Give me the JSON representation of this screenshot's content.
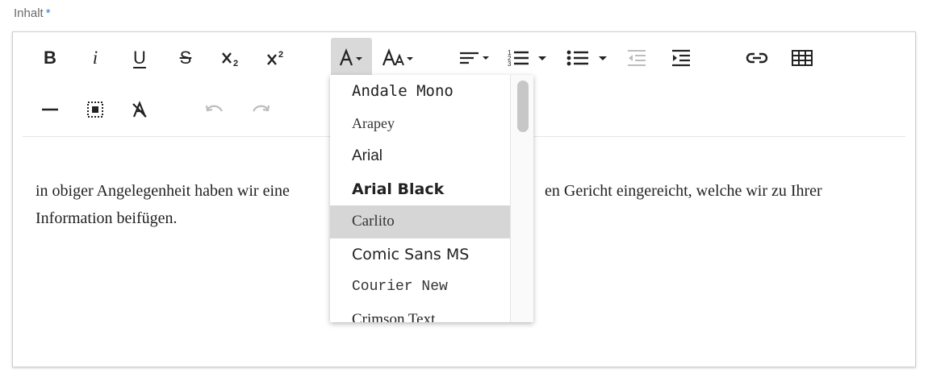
{
  "field": {
    "label": "Inhalt",
    "required_mark": "*"
  },
  "toolbar": {
    "bold": "B",
    "italic": "i",
    "underline": "U",
    "strikethrough": "S"
  },
  "content": {
    "line1_start": "in obiger Angelegenheit haben wir eine ",
    "line1_end": "en Gericht eingereicht, welche wir zu Ihrer",
    "line2": "Information beifügen."
  },
  "font_dropdown": {
    "items": [
      {
        "label": "Andale Mono"
      },
      {
        "label": "Arapey"
      },
      {
        "label": "Arial"
      },
      {
        "label": "Arial Black"
      },
      {
        "label": "Carlito"
      },
      {
        "label": "Comic Sans MS"
      },
      {
        "label": "Courier New"
      },
      {
        "label": "Crimson Text"
      }
    ],
    "selected": "Carlito"
  },
  "icons": [
    "bold-icon",
    "italic-icon",
    "underline-icon",
    "strikethrough-icon",
    "subscript-icon",
    "superscript-icon",
    "font-family-icon",
    "font-size-icon",
    "align-icon",
    "ordered-list-icon",
    "unordered-list-icon",
    "outdent-icon",
    "indent-icon",
    "link-icon",
    "table-icon",
    "horizontal-line-icon",
    "select-all-icon",
    "clear-format-icon",
    "undo-icon",
    "redo-icon"
  ],
  "colors": {
    "required": "#2a7fc6",
    "active_button": "#d9d9d9",
    "selected_item": "#d6d6d6",
    "disabled_icon": "#bdbdbd"
  }
}
